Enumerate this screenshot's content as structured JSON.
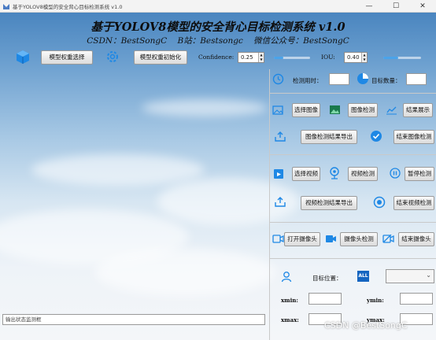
{
  "window": {
    "title": "基于YOLOV8模型的安全背心目标检测系统 v1.0",
    "minimize": "—",
    "maximize": "☐",
    "close": "✕"
  },
  "header": {
    "title": "基于YOLOV8模型的安全背心目标检测系统 v1.0",
    "csdn": "CSDN：BestSongC",
    "bilibili": "B站：Bestsongc",
    "wechat": "微信公众号：BestSongC"
  },
  "toolbar": {
    "model_select": "模型权重选择",
    "model_init": "模型权重初始化",
    "confidence_label": "Confidence:",
    "confidence_value": "0.25",
    "confidence_level": 0.25,
    "iou_label": "IOU:",
    "iou_value": "0.40",
    "iou_level": 0.4
  },
  "stats": {
    "time_label": "检测用时：",
    "time_value": "",
    "count_label": "目标数量：",
    "count_value": ""
  },
  "image_panel": {
    "select": "选择图像",
    "detect": "图像检测",
    "show": "结果展示",
    "export": "图像检测结果导出",
    "end": "结束图像检测"
  },
  "video_panel": {
    "select": "选择视频",
    "detect": "视频检测",
    "pause": "暂停检测",
    "export": "视频检测结果导出",
    "end": "结束视频检测"
  },
  "camera_panel": {
    "open": "打开摄像头",
    "detect": "摄像头检测",
    "end": "结束摄像头"
  },
  "location": {
    "label": "目标位置：",
    "badge": "ALL",
    "select_value": "",
    "xmin": "xmin:",
    "ymin": "ymin:",
    "xmax": "xmax:",
    "ymax": "ymax:"
  },
  "status": {
    "placeholder": "输出状态监测框"
  },
  "watermark": "CSDN @BestSongC",
  "colors": {
    "accent": "#1e88e5",
    "slider_fill": "#4aa3ea"
  }
}
